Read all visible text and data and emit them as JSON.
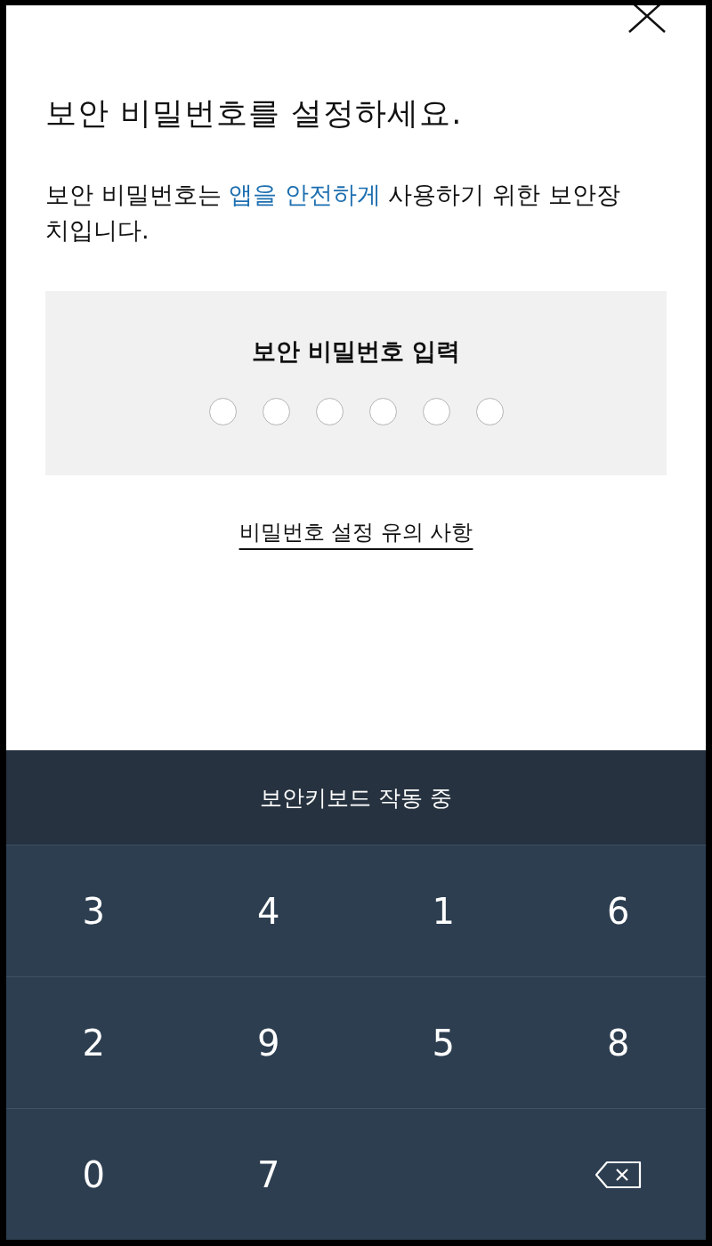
{
  "title": "보안 비밀번호를 설정하세요.",
  "description": [
    {
      "text": "보안 비밀번호는 ",
      "highlight": false
    },
    {
      "text": "앱을 안전하게",
      "highlight": true
    },
    {
      "text": " 사용하기 위한 보안장치입니다.",
      "highlight": false
    }
  ],
  "pin_panel": {
    "label": "보안 비밀번호 입력",
    "dots": [
      {
        "filled": false
      },
      {
        "filled": false
      },
      {
        "filled": false
      },
      {
        "filled": false
      },
      {
        "filled": false
      },
      {
        "filled": false
      }
    ]
  },
  "notice_link": "비밀번호 설정 유의 사항",
  "keyboard": {
    "banner": "보안키보드 작동 중",
    "keys": [
      {
        "kind": "digit",
        "label": "3"
      },
      {
        "kind": "digit",
        "label": "4"
      },
      {
        "kind": "digit",
        "label": "1"
      },
      {
        "kind": "digit",
        "label": "6"
      },
      {
        "kind": "digit",
        "label": "2"
      },
      {
        "kind": "digit",
        "label": "9"
      },
      {
        "kind": "digit",
        "label": "5"
      },
      {
        "kind": "digit",
        "label": "8"
      },
      {
        "kind": "digit",
        "label": "0"
      },
      {
        "kind": "digit",
        "label": "7"
      },
      {
        "kind": "blank"
      },
      {
        "kind": "backspace"
      }
    ]
  }
}
